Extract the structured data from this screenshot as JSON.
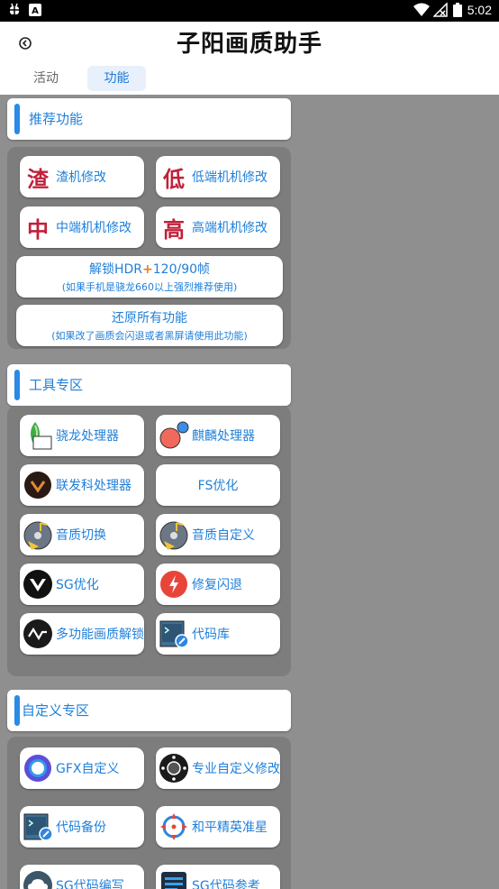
{
  "status_bar": {
    "time": "5:02"
  },
  "header": {
    "title": "子阳画质助手"
  },
  "tabs": [
    {
      "label": "活动",
      "active": false
    },
    {
      "label": "功能",
      "active": true
    }
  ],
  "sections": {
    "recommended": {
      "title": "推荐功能",
      "buttons": [
        {
          "char": "渣",
          "label": "渣机修改"
        },
        {
          "char": "低",
          "label": "低端机机修改"
        },
        {
          "char": "中",
          "label": "中端机机修改"
        },
        {
          "char": "高",
          "label": "高端机机修改"
        }
      ],
      "unlock": {
        "label_a": "解锁HDR",
        "plus": "+",
        "label_b": "120/90帧",
        "note": "(如果手机是骁龙660以上强烈推荐使用)"
      },
      "restore": {
        "label": "还原所有功能",
        "note": "(如果改了画质会闪退或者黑屏请使用此功能)"
      }
    },
    "tools": {
      "title": "工具专区",
      "buttons": [
        {
          "icon": "snapdragon-icon",
          "label": "骁龙处理器"
        },
        {
          "icon": "kirin-icon",
          "label": "麒麟处理器"
        },
        {
          "icon": "mediatek-icon",
          "label": "联发科处理器"
        },
        {
          "icon": "",
          "label": "FS优化"
        },
        {
          "icon": "music-disc-icon",
          "label": "音质切换"
        },
        {
          "icon": "music-disc-icon",
          "label": "音质自定义"
        },
        {
          "icon": "sg-logo-icon",
          "label": "SG优化"
        },
        {
          "icon": "lightning-icon",
          "label": "修复闪退"
        },
        {
          "icon": "pulse-icon",
          "label": "多功能画质解锁"
        },
        {
          "icon": "code-file-icon",
          "label": "代码库"
        }
      ]
    },
    "custom": {
      "title": "自定义专区",
      "buttons": [
        {
          "icon": "gfx-ring-icon",
          "label": "GFX自定义"
        },
        {
          "icon": "dial-icon",
          "label": "专业自定义修改"
        },
        {
          "icon": "code-file-icon",
          "label": "代码备份"
        },
        {
          "icon": "crosshair-icon",
          "label": "和平精英准星"
        },
        {
          "icon": "cloud-icon",
          "label": "SG代码编写"
        },
        {
          "icon": "document-icon",
          "label": "SG代码参考"
        }
      ]
    }
  },
  "colors": {
    "accent": "#1f7fd9",
    "bigchar": "#c0213a",
    "bg": "#8f8f8f"
  }
}
